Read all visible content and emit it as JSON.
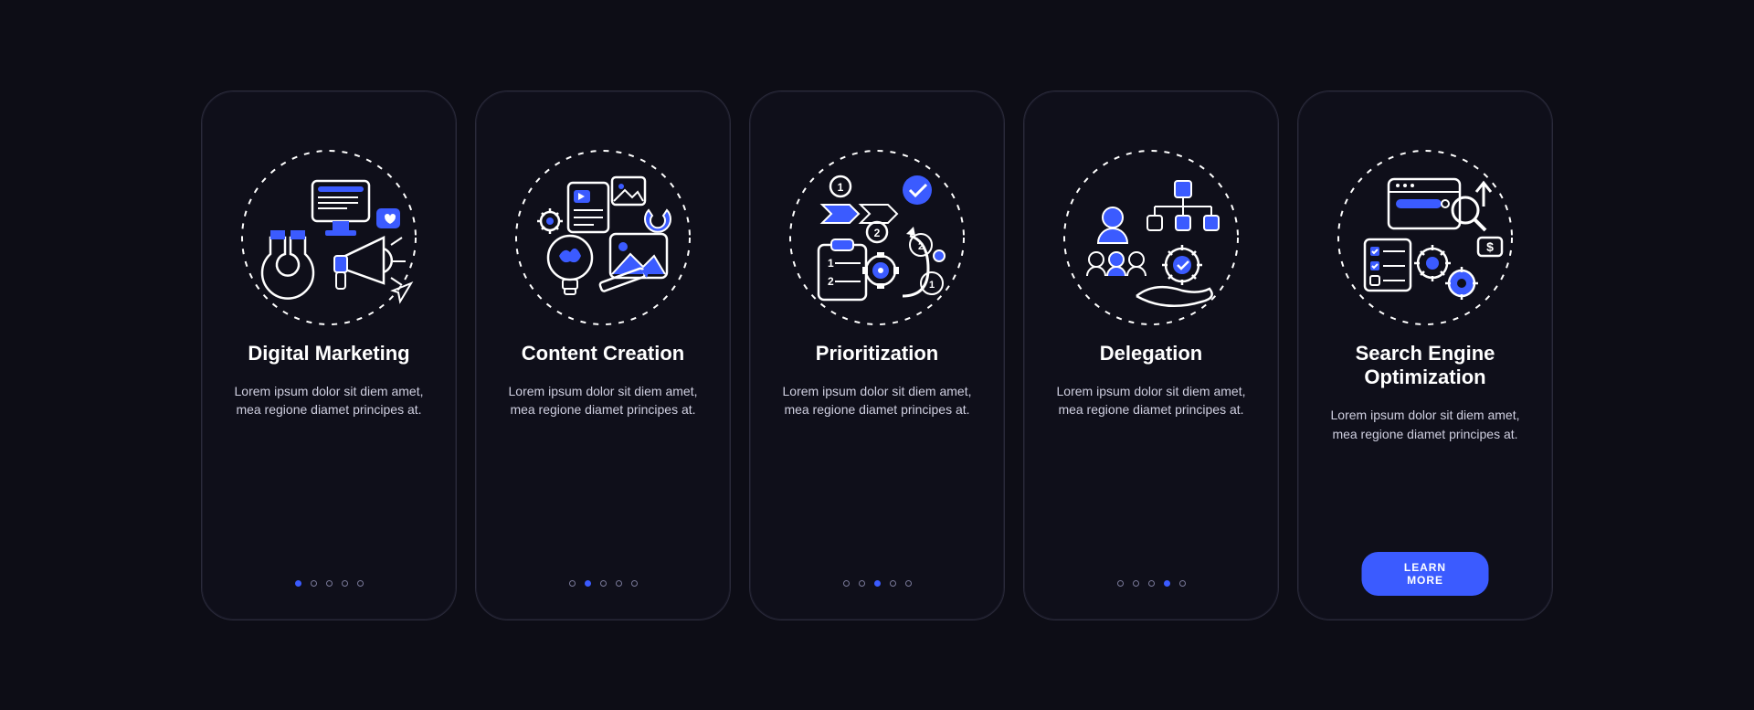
{
  "colors": {
    "accent": "#3b5bff",
    "line": "#ffffff",
    "bg": "#0f0f1a"
  },
  "cta_label": "LEARN MORE",
  "cards": [
    {
      "title": "Digital Marketing",
      "desc": "Lorem ipsum dolor sit diem amet, mea regione diamet principes at.",
      "active_index": 0,
      "icon": "digital-marketing-icon"
    },
    {
      "title": "Content Creation",
      "desc": "Lorem ipsum dolor sit diem amet, mea regione diamet principes at.",
      "active_index": 1,
      "icon": "content-creation-icon"
    },
    {
      "title": "Prioritization",
      "desc": "Lorem ipsum dolor sit diem amet, mea regione diamet principes at.",
      "active_index": 2,
      "icon": "prioritization-icon"
    },
    {
      "title": "Delegation",
      "desc": "Lorem ipsum dolor sit diem amet, mea regione diamet principes at.",
      "active_index": 3,
      "icon": "delegation-icon"
    },
    {
      "title": "Search Engine Optimization",
      "desc": "Lorem ipsum dolor sit diem amet, mea regione diamet principes at.",
      "active_index": 4,
      "icon": "seo-icon",
      "cta": true
    }
  ],
  "dot_count": 5
}
